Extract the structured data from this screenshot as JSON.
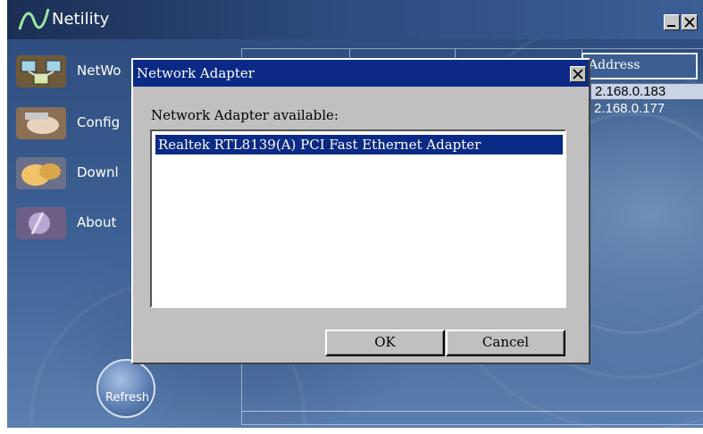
{
  "app": {
    "title": "Netility",
    "nav": [
      {
        "label": "NetWo"
      },
      {
        "label": "Config"
      },
      {
        "label": "Downl"
      },
      {
        "label": "About"
      }
    ],
    "refresh_label": "Refresh"
  },
  "device_list": {
    "address_header": "Address",
    "addresses": [
      "2.168.0.183",
      "2.168.0.177"
    ]
  },
  "dialog": {
    "title": "Network Adapter",
    "label": "Network Adapter available:",
    "adapters": [
      "Realtek RTL8139(A) PCI Fast Ethernet Adapter"
    ],
    "ok_label": "OK",
    "cancel_label": "Cancel"
  },
  "colors": {
    "dialog_title_bg": "#0b2a86",
    "app_bg": "#3d6094"
  },
  "icons": [
    "netility-logo-icon",
    "minimize-icon",
    "close-icon",
    "network-icon",
    "config-icon",
    "download-icon",
    "about-icon"
  ]
}
